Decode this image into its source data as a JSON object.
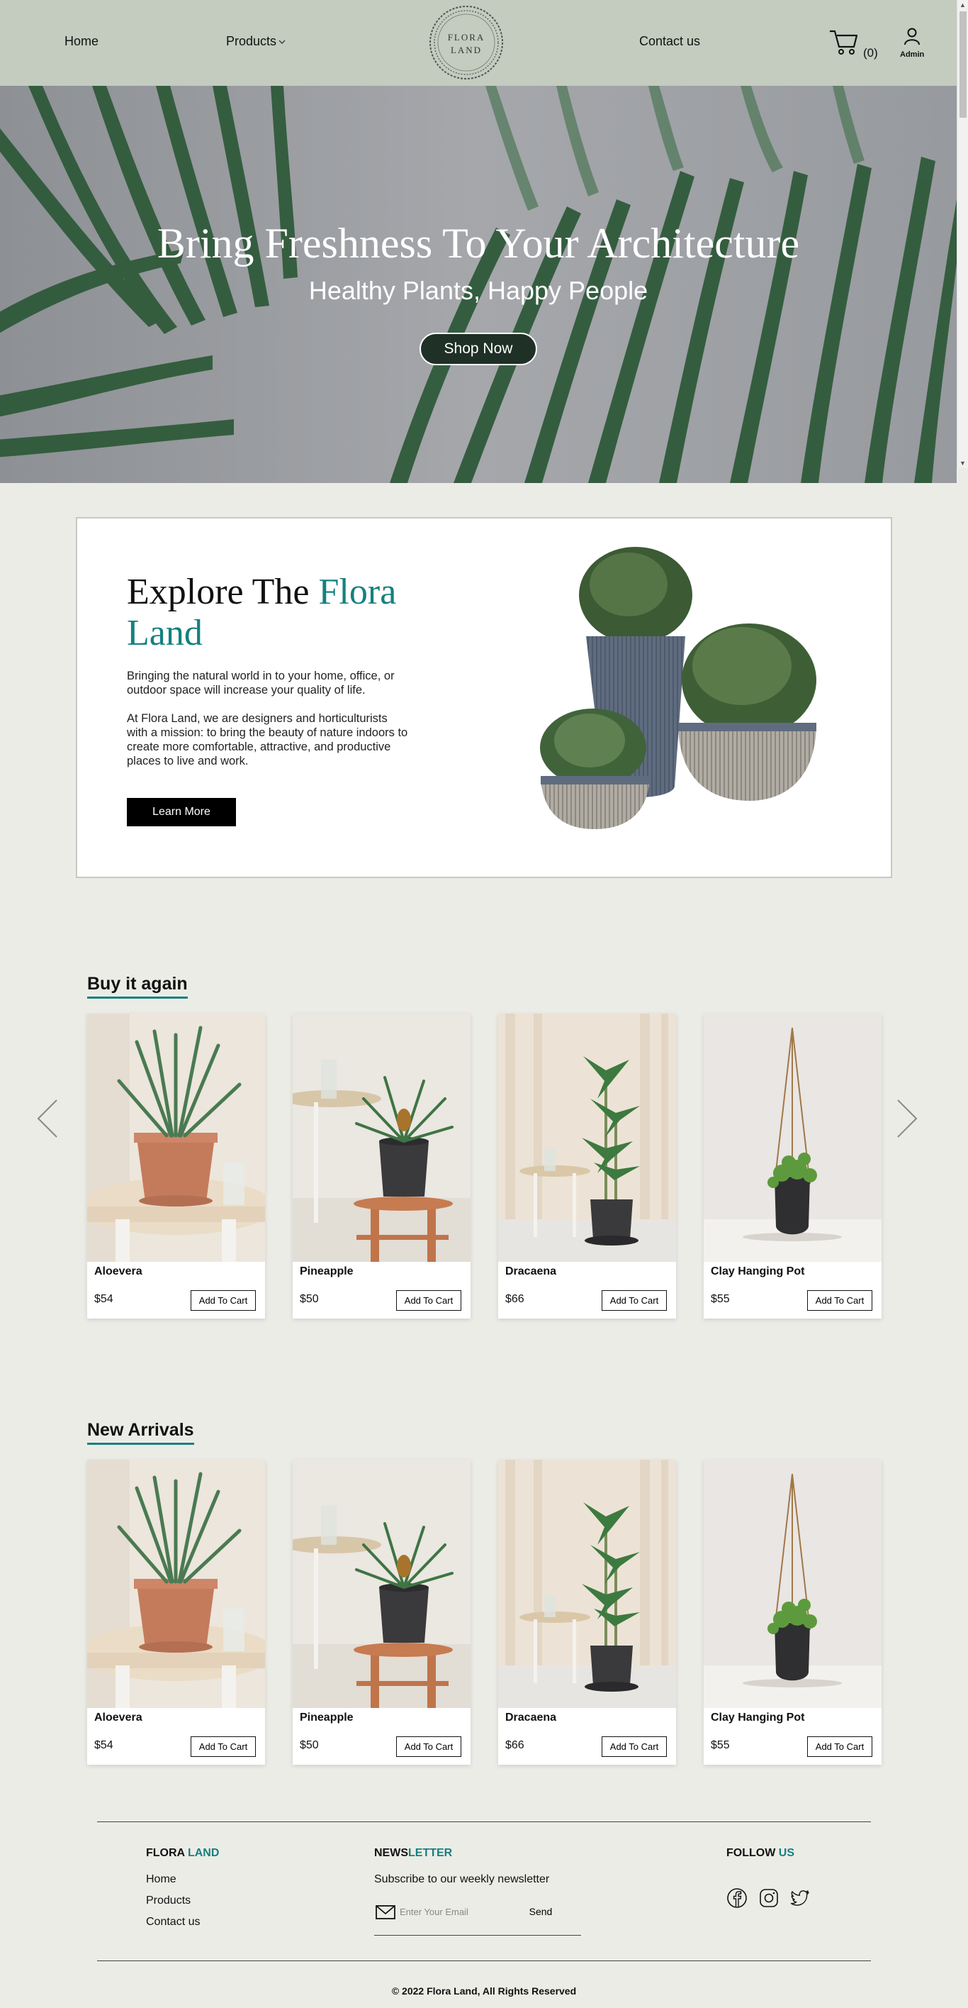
{
  "header": {
    "nav": {
      "home": "Home",
      "products": "Products",
      "contact": "Contact us"
    },
    "logo_text": "FLORA LAND",
    "cart_count": "(0)",
    "admin_label": "Admin"
  },
  "hero": {
    "title": "Bring Freshness To Your Architecture",
    "subtitle": "Healthy Plants, Happy People",
    "cta": "Shop Now"
  },
  "explore": {
    "title_part1": "Explore The ",
    "title_accent": "Flora Land",
    "p1": "Bringing the natural world in to your home, office, or outdoor space will increase your quality of life.",
    "p2": "At Flora Land, we are designers and horticulturists with a mission: to bring the beauty of nature indoors to create more comfortable, attractive, and productive places to live and work.",
    "cta": "Learn More"
  },
  "buy_again": {
    "title": "Buy it again",
    "products": [
      {
        "name": "Aloevera",
        "price": "$54",
        "button": "Add To Cart"
      },
      {
        "name": "Pineapple",
        "price": "$50",
        "button": "Add To Cart"
      },
      {
        "name": "Dracaena",
        "price": "$66",
        "button": "Add To Cart"
      },
      {
        "name": "Clay Hanging Pot",
        "price": "$55",
        "button": "Add To Cart"
      }
    ]
  },
  "new_arrivals": {
    "title": "New Arrivals",
    "products": [
      {
        "name": "Aloevera",
        "price": "$54",
        "button": "Add To Cart"
      },
      {
        "name": "Pineapple",
        "price": "$50",
        "button": "Add To Cart"
      },
      {
        "name": "Dracaena",
        "price": "$66",
        "button": "Add To Cart"
      },
      {
        "name": "Clay Hanging Pot",
        "price": "$55",
        "button": "Add To Cart"
      }
    ]
  },
  "footer": {
    "brand_part1": "FLORA ",
    "brand_accent": "LAND",
    "links": [
      "Home",
      "Products",
      "Contact us"
    ],
    "news_part1": "NEWS",
    "news_accent": "LETTER",
    "news_text": "Subscribe to our weekly newsletter",
    "email_placeholder": "Enter Your Email",
    "send": "Send",
    "follow_part1": "FOLLOW ",
    "follow_accent": "US",
    "social_icons": [
      "facebook-icon",
      "instagram-icon",
      "twitter-icon"
    ],
    "copyright": "© 2022 Flora Land, All Rights Reserved"
  },
  "colors": {
    "accent": "#15807f",
    "header_bg": "#c4cbbf",
    "page_bg": "#ecece7",
    "shop_button": "#1f3026"
  }
}
